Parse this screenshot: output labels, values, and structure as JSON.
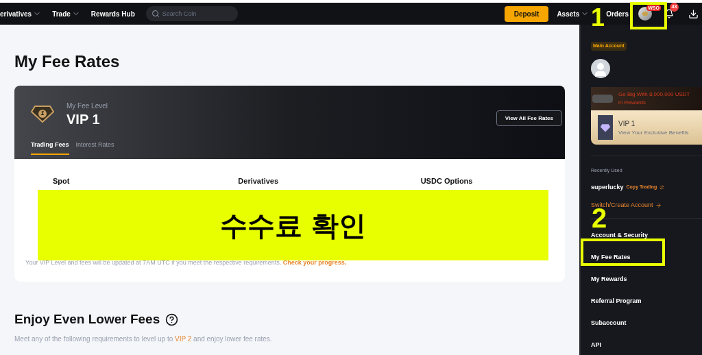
{
  "nav": {
    "items": [
      {
        "label": "erivatives",
        "caret": true
      },
      {
        "label": "Trade",
        "caret": true
      },
      {
        "label": "Rewards Hub",
        "caret": false
      }
    ],
    "search": {
      "placeholder": "Search Coin"
    },
    "deposit": "Deposit",
    "right_items": [
      {
        "label": "Assets",
        "caret": true
      },
      {
        "label": "Orders",
        "caret": false
      }
    ],
    "avatar_badge": "WSO",
    "notification_count": "43"
  },
  "main": {
    "title": "My Fee Rates",
    "fee_card": {
      "label": "My Fee Level",
      "level": "VIP 1",
      "badge_number": "1",
      "button": "View All Fee Rates",
      "tabs": [
        {
          "label": "Trading Fees",
          "selected": true
        },
        {
          "label": "Interest Rates",
          "selected": false
        }
      ],
      "columns": [
        "Spot",
        "Derivatives",
        "USDC Options"
      ],
      "note": "Your VIP Level and fees will be updated at 7AM UTC if you meet the respective requirements.",
      "note_link": "Check your progress."
    },
    "section": {
      "title": "Enjoy Even Lower Fees",
      "before": "Meet any of the following requirements to level up to",
      "highlight": "VIP 2",
      "after": "and enjoy lower fee rates."
    }
  },
  "panel": {
    "account_badge": "Main Account",
    "banner": "Go Big With 8,000,000 USDT in Rewards",
    "vip_card": {
      "title": "VIP 1",
      "subtitle": "View Your Exclusive Benefits"
    },
    "recent_label": "Recently Used",
    "recent": {
      "name": "superlucky",
      "tag": "Copy Trading"
    },
    "switch_link": "Switch/Create Account",
    "menu": [
      "Account & Security",
      "My Fee Rates",
      "My Rewards",
      "Referral Program",
      "Subaccount",
      "API"
    ]
  },
  "annotations": {
    "caption": "수수료 확인",
    "markers": [
      "1",
      "2"
    ]
  }
}
